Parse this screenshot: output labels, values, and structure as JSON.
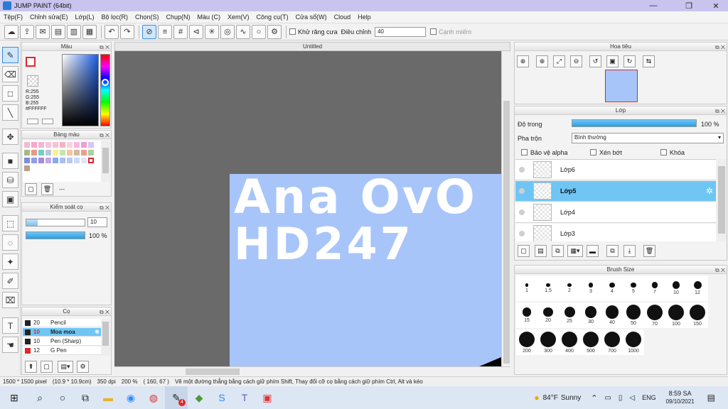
{
  "window": {
    "title": "JUMP PAINT (64bit)",
    "min": "—",
    "max": "❐",
    "close": "✕"
  },
  "menu": [
    "Tệp(F)",
    "Chỉnh sửa(E)",
    "Lớp(L)",
    "Bộ lọc(R)",
    "Chọn(S)",
    "Chụp(N)",
    "Màu (C)",
    "Xem(V)",
    "Công cụ(T)",
    "Cửa sổ(W)",
    "Cloud",
    "Help"
  ],
  "toolbar": {
    "antialias_label": "Khử răng cưa",
    "adjust_label": "Điều chỉnh",
    "adjust_value": "40",
    "snap_label": "Cạnh miếm"
  },
  "canvas": {
    "tab_title": "Untitled",
    "text_line1": "Ana OvO",
    "text_line2": "HD247",
    "paper_color": "#a8c5fa"
  },
  "color_panel": {
    "title": "Màu",
    "r": "R:255",
    "g": "G:255",
    "b": "B:255",
    "hex": "#FFFFFF"
  },
  "palette_panel": {
    "title": "Bảng màu",
    "more": "---"
  },
  "brush_control": {
    "title": "Kiểm soát cọ",
    "size": "10",
    "opacity": "100 %",
    "opacity_fraction": 1.0
  },
  "brush_panel": {
    "title": "Cọ",
    "items": [
      {
        "size": "20",
        "name": "Pencil",
        "color": "#222222"
      },
      {
        "size": "10",
        "name": "Moa moa",
        "color": "#222222"
      },
      {
        "size": "10",
        "name": "Pen (Sharp)",
        "color": "#222222"
      },
      {
        "size": "12",
        "name": "G Pen",
        "color": "#e0262b"
      }
    ]
  },
  "navigator": {
    "title": "Hoa tiêu"
  },
  "layer_panel": {
    "title": "Lớp",
    "opacity_label": "Độ trong",
    "opacity_value": "100 %",
    "blend_label": "Pha trộn",
    "blend_value": "Bình thường",
    "protect_alpha": "Bảo vệ alpha",
    "clipping": "Xén bớt",
    "lock": "Khóa",
    "layers": [
      "Lớp6",
      "Lớp5",
      "Lớp4",
      "Lớp3"
    ],
    "selected": 1
  },
  "brush_size_panel": {
    "title": "Brush Size",
    "sizes": [
      "1",
      "1.5",
      "2",
      "3",
      "4",
      "5",
      "7",
      "10",
      "12",
      "15",
      "20",
      "25",
      "30",
      "40",
      "50",
      "70",
      "100",
      "150",
      "200",
      "300",
      "400",
      "500",
      "700",
      "1000"
    ]
  },
  "status": {
    "size": "1500 * 1500 pixel",
    "phys": "(10.9 * 10.9cm)",
    "dpi": "350 dpi",
    "zoom": "200 %",
    "coord": "( 160, 67 )",
    "hint": "Vẽ một đường thẳng bằng cách giữ phím Shift, Thay đổi cỡ cọ bằng cách giữ phím Ctrl, Alt và kéo"
  },
  "taskbar": {
    "weather_temp": "84°F",
    "weather_text": "Sunny",
    "lang": "ENG",
    "time": "8:59 SA",
    "date": "09/10/2021",
    "badge": "4"
  }
}
